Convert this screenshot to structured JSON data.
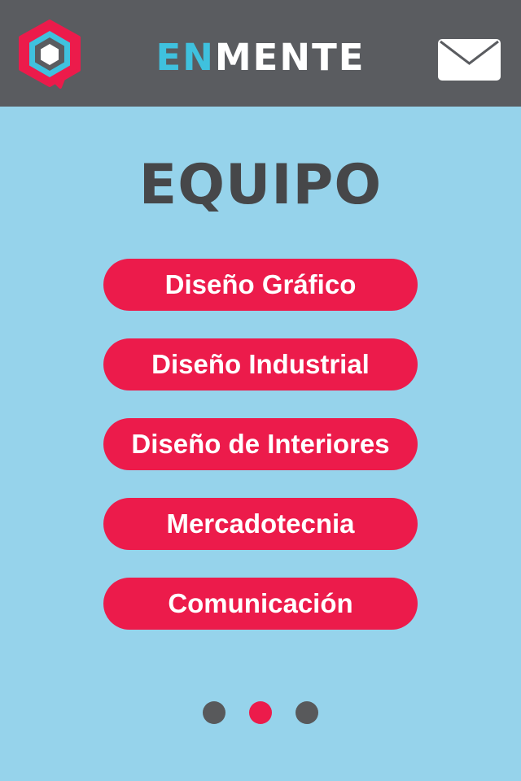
{
  "header": {
    "logo_icon": "hexagon-speech-bubble-logo",
    "brand_prefix": "EN",
    "brand_suffix": "MENTE",
    "mail_icon": "envelope-icon"
  },
  "page": {
    "title": "EQUIPO"
  },
  "menu": {
    "items": [
      {
        "label": "Diseño Gráfico"
      },
      {
        "label": "Diseño Industrial"
      },
      {
        "label": "Diseño de Interiores"
      },
      {
        "label": "Mercadotecnia"
      },
      {
        "label": "Comunicación"
      }
    ]
  },
  "pagination": {
    "total_pages": 3,
    "active_page": 2
  },
  "colors": {
    "header_bg": "#5a5c60",
    "page_bg": "#96d3eb",
    "accent": "#ec1b4b",
    "brand_cyan": "#3fc1de",
    "title_text": "#464749",
    "dot_inactive": "#58595b"
  }
}
